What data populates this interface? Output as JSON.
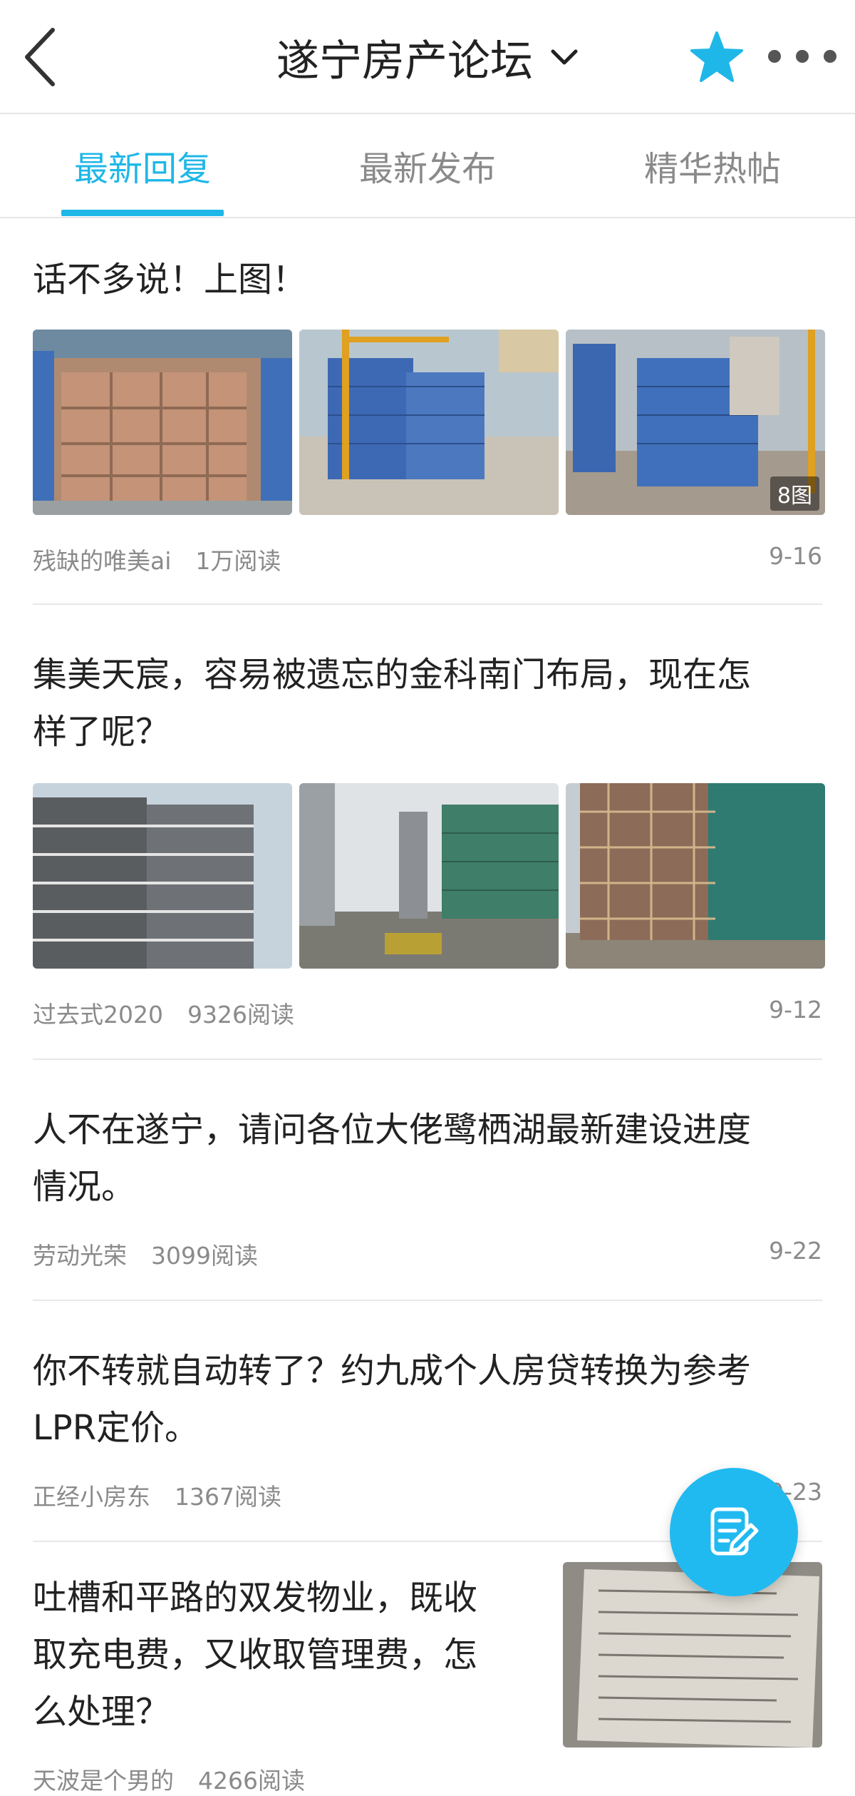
{
  "header": {
    "title": "遂宁房产论坛",
    "icons": {
      "back": "back-chevron-icon",
      "dropdown": "chevron-down-icon",
      "favorite": "star-icon",
      "more": "more-dots-icon"
    },
    "accent": "#1fb7e8"
  },
  "tabs": [
    {
      "label": "最新回复",
      "active": true
    },
    {
      "label": "最新发布",
      "active": false
    },
    {
      "label": "精华热帖",
      "active": false
    }
  ],
  "posts": [
    {
      "title": "话不多说！上图！",
      "author": "残缺的唯美ai",
      "reads": "1万阅读",
      "date": "9-16",
      "image_badge": "8图"
    },
    {
      "title_line1": "集美天宸，容易被遗忘的金科南门布局，现在怎",
      "title_line2": "样了呢？",
      "author": "过去式2020",
      "reads": "9326阅读",
      "date": "9-12"
    },
    {
      "title_line1": "人不在遂宁，请问各位大佬鹭栖湖最新建设进度",
      "title_line2": "情况。",
      "author": "劳动光荣",
      "reads": "3099阅读",
      "date": "9-22"
    },
    {
      "title_line1": "你不转就自动转了？约九成个人房贷转换为参考",
      "title_line2": "LPR定价。",
      "author": "正经小房东",
      "reads": "1367阅读",
      "date": "9-23"
    },
    {
      "title_line1": "吐槽和平路的双发物业，既收",
      "title_line2": "取充电费，又收取管理费，怎",
      "title_line3": "么处理？",
      "author": "天波是个男的",
      "reads": "4266阅读"
    }
  ],
  "fab": {
    "icon": "compose-icon",
    "color": "#21baf0"
  }
}
